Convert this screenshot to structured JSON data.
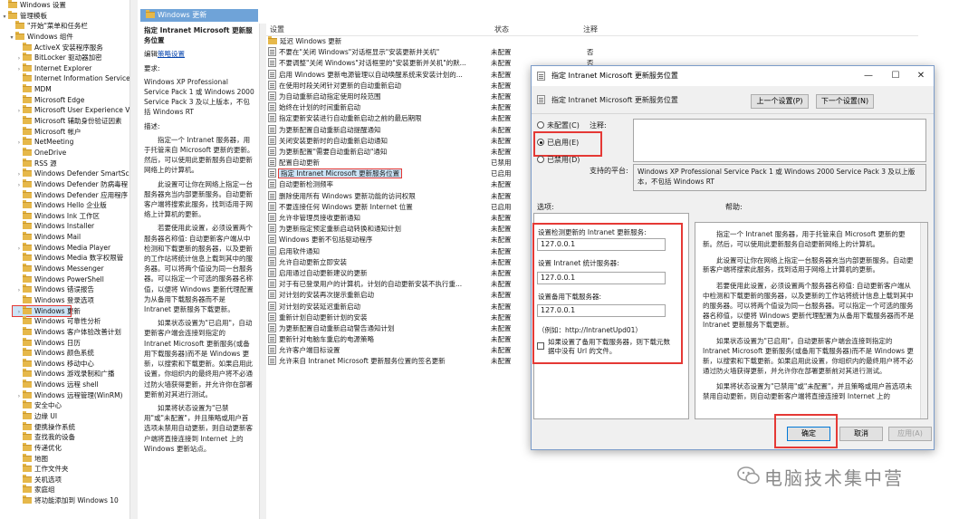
{
  "tree": {
    "items": [
      {
        "label": "Windows 设置",
        "depth": 0,
        "toggle": ""
      },
      {
        "label": "管理模板",
        "depth": 0,
        "toggle": "▾"
      },
      {
        "label": "\"开始\"菜单和任务栏",
        "depth": 1,
        "toggle": ""
      },
      {
        "label": "Windows 组件",
        "depth": 1,
        "toggle": "▾"
      },
      {
        "label": "ActiveX 安装程序服务",
        "depth": 2,
        "toggle": ""
      },
      {
        "label": "BitLocker 驱动器加密",
        "depth": 2,
        "toggle": "›"
      },
      {
        "label": "Internet Explorer",
        "depth": 2,
        "toggle": "›"
      },
      {
        "label": "Internet Information Services",
        "depth": 2,
        "toggle": ""
      },
      {
        "label": "MDM",
        "depth": 2,
        "toggle": ""
      },
      {
        "label": "Microsoft Edge",
        "depth": 2,
        "toggle": ""
      },
      {
        "label": "Microsoft User Experience Vi",
        "depth": 2,
        "toggle": "›"
      },
      {
        "label": "Microsoft 辅助身份验证因素",
        "depth": 2,
        "toggle": ""
      },
      {
        "label": "Microsoft 帐户",
        "depth": 2,
        "toggle": ""
      },
      {
        "label": "NetMeeting",
        "depth": 2,
        "toggle": "›"
      },
      {
        "label": "OneDrive",
        "depth": 2,
        "toggle": ""
      },
      {
        "label": "RSS 源",
        "depth": 2,
        "toggle": ""
      },
      {
        "label": "Windows Defender SmartScre",
        "depth": 2,
        "toggle": "›"
      },
      {
        "label": "Windows Defender 防病毒程",
        "depth": 2,
        "toggle": "›"
      },
      {
        "label": "Windows Defender 应用程序",
        "depth": 2,
        "toggle": ""
      },
      {
        "label": "Windows Hello 企业版",
        "depth": 2,
        "toggle": ""
      },
      {
        "label": "Windows Ink 工作区",
        "depth": 2,
        "toggle": ""
      },
      {
        "label": "Windows Installer",
        "depth": 2,
        "toggle": ""
      },
      {
        "label": "Windows Mail",
        "depth": 2,
        "toggle": ""
      },
      {
        "label": "Windows Media Player",
        "depth": 2,
        "toggle": "›"
      },
      {
        "label": "Windows Media 数字权限管",
        "depth": 2,
        "toggle": ""
      },
      {
        "label": "Windows Messenger",
        "depth": 2,
        "toggle": ""
      },
      {
        "label": "Windows PowerShell",
        "depth": 2,
        "toggle": ""
      },
      {
        "label": "Windows 错误报告",
        "depth": 2,
        "toggle": "›"
      },
      {
        "label": "Windows 登录选项",
        "depth": 2,
        "toggle": ""
      },
      {
        "label": "Windows 更新",
        "depth": 2,
        "toggle": "›",
        "selected": true
      },
      {
        "label": "Windows 可靠性分析",
        "depth": 2,
        "toggle": ""
      },
      {
        "label": "Windows 客户体验改善计划",
        "depth": 2,
        "toggle": ""
      },
      {
        "label": "Windows 日历",
        "depth": 2,
        "toggle": ""
      },
      {
        "label": "Windows 颜色系统",
        "depth": 2,
        "toggle": ""
      },
      {
        "label": "Windows 移动中心",
        "depth": 2,
        "toggle": ""
      },
      {
        "label": "Windows 游戏录制和广播",
        "depth": 2,
        "toggle": ""
      },
      {
        "label": "Windows 远程 shell",
        "depth": 2,
        "toggle": ""
      },
      {
        "label": "Windows 远程管理(WinRM)",
        "depth": 2,
        "toggle": "›"
      },
      {
        "label": "安全中心",
        "depth": 2,
        "toggle": ""
      },
      {
        "label": "边缘 UI",
        "depth": 2,
        "toggle": ""
      },
      {
        "label": "便携操作系统",
        "depth": 2,
        "toggle": ""
      },
      {
        "label": "查找我的设备",
        "depth": 2,
        "toggle": ""
      },
      {
        "label": "传递优化",
        "depth": 2,
        "toggle": ""
      },
      {
        "label": "地图",
        "depth": 2,
        "toggle": ""
      },
      {
        "label": "工作文件夹",
        "depth": 2,
        "toggle": ""
      },
      {
        "label": "关机选项",
        "depth": 2,
        "toggle": ""
      },
      {
        "label": "家庭组",
        "depth": 2,
        "toggle": ""
      },
      {
        "label": "将功能添加到 Windows 10",
        "depth": 2,
        "toggle": ""
      }
    ]
  },
  "header": {
    "title": "Windows 更新"
  },
  "description": {
    "title": "指定 Intranet Microsoft 更新服务位置",
    "edit_prefix": "编辑",
    "edit_link": "策略设置",
    "req_label": "要求:",
    "requirements": "Windows XP Professional Service Pack 1 或 Windows 2000 Service Pack 3 及以上版本，不包括 Windows RT",
    "desc_label": "描述:",
    "paragraphs": [
      "指定一个 Intranet 服务器，用于托管来自 Microsoft 更新的更新。然后，可以使用此更新服务自动更新网络上的计算机。",
      "此设置可让你在网络上指定一台服务器充当内部更新服务。自动更新客户端将搜索此服务，找到适用于网络上计算机的更新。",
      "若要使用此设置，必须设置两个服务器名称值: 自动更新客户端从中检测和下载更新的服务器，以及更新的工作站将统计信息上载到其中的服务器。可以将两个值设为同一台服务器。可以指定一个可选的服务器名称值，以便将 Windows 更新代理配置为从备用下载服务器而不是 Intranet 更新服务下载更新。",
      "如果状态设置为\"已启用\"，自动更新客户端会连接到指定的 Intranet Microsoft 更新服务(或备用下载服务器)而不是 Windows 更新，以搜索和下载更新。如果启用此设置，你组织内的最终用户将不必通过防火墙获得更新，并允许你在部署更新前对其进行测试。",
      "如果将状态设置为\"已禁用\"或\"未配置\"，并且策略或用户首选项未禁用自动更新，则自动更新客户端将直接连接到 Internet 上的 Windows 更新站点。"
    ]
  },
  "list": {
    "headers": {
      "setting": "设置",
      "state": "状态",
      "comment": "注释"
    },
    "rows": [
      {
        "name": "延迟 Windows 更新",
        "state": "",
        "comment": "",
        "icon": "folder"
      },
      {
        "name": "不要在\"关闭 Windows\"对话框显示\"安装更新并关机\"",
        "state": "未配置",
        "comment": "否",
        "icon": "policy"
      },
      {
        "name": "不要调整\"关闭 Windows\"对话框里的\"安装更新并关机\"的默...",
        "state": "未配置",
        "comment": "否",
        "icon": "policy"
      },
      {
        "name": "启用 Windows 更新电源管理以自动唤醒系统来安装计划的...",
        "state": "未配置",
        "comment": "",
        "icon": "policy"
      },
      {
        "name": "在使用时段关闭针对更新的自动重新启动",
        "state": "未配置",
        "comment": "",
        "icon": "policy"
      },
      {
        "name": "为自动重新启动指定使用时段范围",
        "state": "未配置",
        "comment": "",
        "icon": "policy"
      },
      {
        "name": "始终在计划的时间重新启动",
        "state": "未配置",
        "comment": "",
        "icon": "policy"
      },
      {
        "name": "指定更新安装进行自动重新启动之前的最后期限",
        "state": "未配置",
        "comment": "",
        "icon": "policy"
      },
      {
        "name": "为更新配置自动重新启动提醒通知",
        "state": "未配置",
        "comment": "",
        "icon": "policy"
      },
      {
        "name": "关闭安装更新时的自动重新启动通知",
        "state": "未配置",
        "comment": "",
        "icon": "policy"
      },
      {
        "name": "为更新配置\"需要自动重新启动\"通知",
        "state": "未配置",
        "comment": "",
        "icon": "policy"
      },
      {
        "name": "配置自动更新",
        "state": "已禁用",
        "comment": "",
        "icon": "policy"
      },
      {
        "name": "指定 Intranet Microsoft 更新服务位置",
        "state": "已启用",
        "comment": "",
        "icon": "policy",
        "selected": true
      },
      {
        "name": "自动更新检测频率",
        "state": "未配置",
        "comment": "",
        "icon": "policy"
      },
      {
        "name": "删除使用所有 Windows 更新功能的访问权限",
        "state": "未配置",
        "comment": "",
        "icon": "policy"
      },
      {
        "name": "不要连接任何 Windows 更新 Internet 位置",
        "state": "已启用",
        "comment": "",
        "icon": "policy"
      },
      {
        "name": "允许非管理员接收更新通知",
        "state": "未配置",
        "comment": "",
        "icon": "policy"
      },
      {
        "name": "为更新指定预定重新启动转换和通知计划",
        "state": "未配置",
        "comment": "",
        "icon": "policy"
      },
      {
        "name": "Windows 更新不包括驱动程序",
        "state": "未配置",
        "comment": "",
        "icon": "policy"
      },
      {
        "name": "启用软件通知",
        "state": "未配置",
        "comment": "",
        "icon": "policy"
      },
      {
        "name": "允许自动更新立即安装",
        "state": "未配置",
        "comment": "",
        "icon": "policy"
      },
      {
        "name": "启用通过自动更新建议的更新",
        "state": "未配置",
        "comment": "",
        "icon": "policy"
      },
      {
        "name": "对于有已登录用户的计算机，计划的自动更新安装不执行重...",
        "state": "未配置",
        "comment": "",
        "icon": "policy"
      },
      {
        "name": "对计划的安装再次提示重新启动",
        "state": "未配置",
        "comment": "",
        "icon": "policy"
      },
      {
        "name": "对计划的安装延迟重新启动",
        "state": "未配置",
        "comment": "",
        "icon": "policy"
      },
      {
        "name": "重新计划自动更新计划的安装",
        "state": "未配置",
        "comment": "",
        "icon": "policy"
      },
      {
        "name": "为更新配置自动重新启动警告通知计划",
        "state": "未配置",
        "comment": "",
        "icon": "policy"
      },
      {
        "name": "更新针对电脑车重启的电源策略",
        "state": "未配置",
        "comment": "",
        "icon": "policy"
      },
      {
        "name": "允许客户端目标设置",
        "state": "未配置",
        "comment": "",
        "icon": "policy"
      },
      {
        "name": "允许来自 Intranet Microsoft 更新服务位置的签名更新",
        "state": "未配置",
        "comment": "",
        "icon": "policy"
      }
    ]
  },
  "dialog": {
    "title": "指定 Intranet Microsoft 更新服务位置",
    "subtitle": "指定 Intranet Microsoft 更新服务位置",
    "prev_label": "上一个设置(P)",
    "next_label": "下一个设置(N)",
    "radio_not_configured": "未配置(C)",
    "radio_enabled": "已启用(E)",
    "radio_disabled": "已禁用(D)",
    "comment_label": "注释:",
    "supported_label": "支持的平台:",
    "supported_text": "Windows XP Professional Service Pack 1 或 Windows 2000 Service Pack 3 及以上版本，不包括 Windows RT",
    "options_label": "选项:",
    "help_label": "帮助:",
    "update_server_label": "设置检测更新的 Intranet 更新服务:",
    "update_server_value": "127.0.0.1",
    "stats_server_label": "设置 Intranet 统计服务器:",
    "stats_server_value": "127.0.0.1",
    "alt_download_label": "设置备用下载服务器:",
    "alt_download_value": "127.0.0.1",
    "example": "（例如：http://IntranetUpd01）",
    "checkbox_label": "如果设置了备用下载服务器，则下载元数据中没有 Url 的文件。",
    "help_paragraphs": [
      "指定一个 Intranet 服务器，用于托管来自 Microsoft 更新的更新。然后，可以使用此更新服务自动更新网络上的计算机。",
      "此设置可让你在网络上指定一台服务器充当内部更新服务。自动更新客户端将搜索此服务，找到适用于网络上计算机的更新。",
      "若要使用此设置，必须设置两个服务器名称值: 自动更新客户端从中检测和下载更新的服务器，以及更新的工作站将统计信息上载到其中的服务器。可以将两个值设为同一台服务器。可以指定一个可选的服务器名称值，以便将 Windows 更新代理配置为从备用下载服务器而不是 Intranet 更新服务下载更新。",
      "如果状态设置为\"已启用\"，自动更新客户端会连接到指定的 Intranet Microsoft 更新服务(或备用下载服务器)而不是 Windows 更新，以搜索和下载更新。如果启用此设置，你组织内的最终用户将不必通过防火墙获得更新，并允许你在部署更新前对其进行测试。",
      "如果将状态设置为\"已禁用\"或\"未配置\"，并且策略或用户首选项未禁用自动更新，则自动更新客户端将直接连接到 Internet 上的"
    ],
    "ok_label": "确定",
    "cancel_label": "取消",
    "apply_label": "应用(A)"
  },
  "watermark": {
    "text": "电脑技术集中营"
  },
  "colors": {
    "highlight": "#e53935",
    "selection": "#cce4f7",
    "header_blue": "#6fa3d8",
    "link": "#0645ad"
  }
}
